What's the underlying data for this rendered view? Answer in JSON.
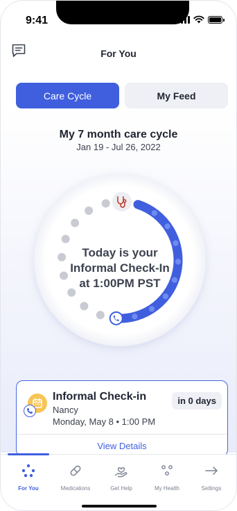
{
  "status_bar": {
    "time": "9:41"
  },
  "header": {
    "title": "For You",
    "left_icon": "chat-feedback-icon"
  },
  "segments": {
    "active": "Care Cycle",
    "inactive": "My Feed"
  },
  "cycle": {
    "title": "My 7 month care cycle",
    "dates": "Jan 19 - Jul 26, 2022",
    "center_line1": "Today is your",
    "center_line2": "Informal Check-In",
    "center_line3": "at 1:00PM PST",
    "progress_fraction": 0.46,
    "accent_color": "#3f5fde",
    "pending_dot_color": "#c9cbd2"
  },
  "appointment": {
    "title": "Informal Check-in",
    "name": "Nancy",
    "when": "Monday, May 8 • 1:00 PM",
    "badge": "in 0 days",
    "action": "View Details"
  },
  "tabs": [
    {
      "label": "For You",
      "icon": "dots-cluster-icon",
      "active": true
    },
    {
      "label": "Medications",
      "icon": "pill-icon",
      "active": false
    },
    {
      "label": "Get Help",
      "icon": "heart-hand-icon",
      "active": false
    },
    {
      "label": "My Health",
      "icon": "nodes-icon",
      "active": false
    },
    {
      "label": "Settings",
      "icon": "arrow-right-icon",
      "active": false
    }
  ]
}
